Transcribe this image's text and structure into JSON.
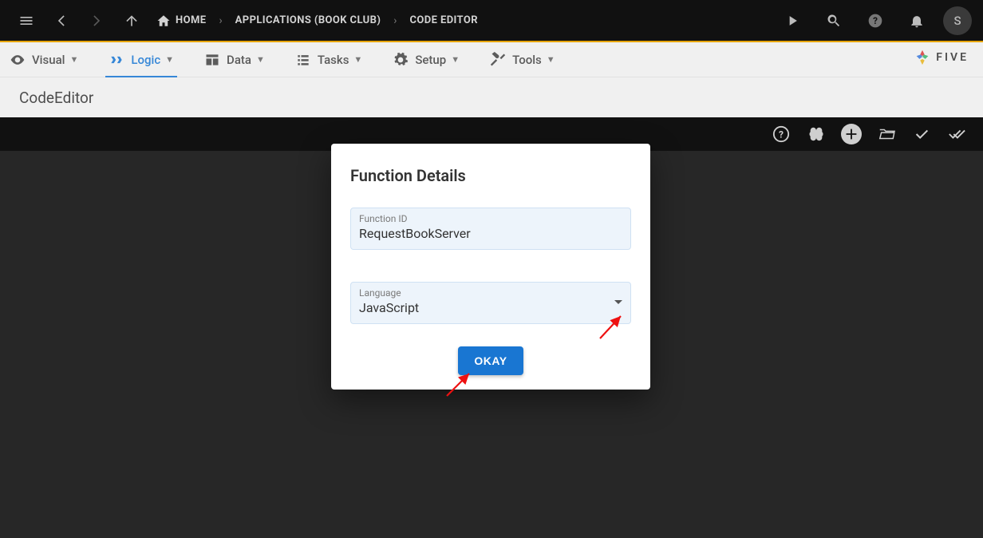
{
  "topbar": {
    "breadcrumb": [
      {
        "label": "HOME",
        "icon": "home-icon"
      },
      {
        "label": "APPLICATIONS (BOOK CLUB)"
      },
      {
        "label": "CODE EDITOR"
      }
    ],
    "avatar_initial": "S"
  },
  "subnav": {
    "items": [
      {
        "label": "Visual",
        "icon": "eye-icon",
        "active": false
      },
      {
        "label": "Logic",
        "icon": "logic-icon",
        "active": true
      },
      {
        "label": "Data",
        "icon": "table-icon",
        "active": false
      },
      {
        "label": "Tasks",
        "icon": "list-icon",
        "active": false
      },
      {
        "label": "Setup",
        "icon": "gear-icon",
        "active": false
      },
      {
        "label": "Tools",
        "icon": "tools-icon",
        "active": false
      }
    ],
    "brand": "FIVE"
  },
  "page_title": "CodeEditor",
  "editor_toolbar_icons": [
    "help-icon",
    "brain-icon",
    "add-icon",
    "open-icon",
    "check-icon",
    "check-all-icon"
  ],
  "dialog": {
    "title": "Function Details",
    "fields": {
      "function_id": {
        "label": "Function ID",
        "value": "RequestBookServer"
      },
      "language": {
        "label": "Language",
        "value": "JavaScript"
      }
    },
    "ok_label": "OKAY"
  }
}
